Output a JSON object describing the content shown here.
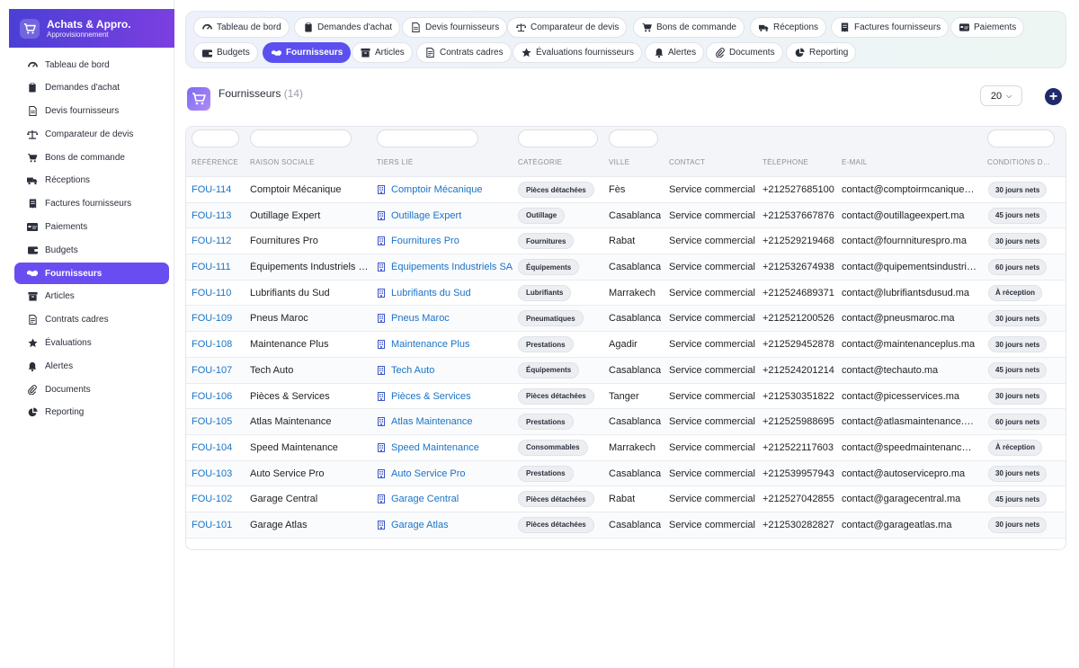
{
  "app": {
    "title": "Achats & Appro.",
    "subtitle": "Approvisionnement"
  },
  "colors": {
    "accent": "#6a4df0",
    "tab_active": "#5b50ef",
    "link": "#1a73c7",
    "add_button": "#1f2a6b"
  },
  "sidebar": {
    "items": [
      {
        "label": "Tableau de bord",
        "icon": "dashboard-icon"
      },
      {
        "label": "Demandes d'achat",
        "icon": "clipboard-icon"
      },
      {
        "label": "Devis fournisseurs",
        "icon": "document-icon"
      },
      {
        "label": "Comparateur de devis",
        "icon": "scale-icon"
      },
      {
        "label": "Bons de commande",
        "icon": "cart-icon"
      },
      {
        "label": "Réceptions",
        "icon": "truck-icon"
      },
      {
        "label": "Factures fournisseurs",
        "icon": "invoice-icon"
      },
      {
        "label": "Paiements",
        "icon": "card-icon"
      },
      {
        "label": "Budgets",
        "icon": "wallet-icon"
      },
      {
        "label": "Fournisseurs",
        "icon": "handshake-icon",
        "active": true
      },
      {
        "label": "Articles",
        "icon": "box-icon"
      },
      {
        "label": "Contrats cadres",
        "icon": "contract-icon"
      },
      {
        "label": "Évaluations",
        "icon": "star-icon"
      },
      {
        "label": "Alertes",
        "icon": "bell-icon"
      },
      {
        "label": "Documents",
        "icon": "paperclip-icon"
      },
      {
        "label": "Reporting",
        "icon": "pie-chart-icon"
      }
    ]
  },
  "tabs": {
    "items": [
      {
        "label": "Tableau de bord",
        "icon": "dashboard-icon"
      },
      {
        "label": "Demandes d'achat",
        "icon": "clipboard-icon"
      },
      {
        "label": "Devis fournisseurs",
        "icon": "document-icon"
      },
      {
        "label": "Comparateur de devis",
        "icon": "scale-icon"
      },
      {
        "label": "Bons de commande",
        "icon": "cart-icon"
      },
      {
        "label": "Réceptions",
        "icon": "truck-icon"
      },
      {
        "label": "Factures fournisseurs",
        "icon": "invoice-icon"
      },
      {
        "label": "Paiements",
        "icon": "card-icon"
      },
      {
        "label": "Budgets",
        "icon": "wallet-icon"
      },
      {
        "label": "Fournisseurs",
        "icon": "handshake-icon",
        "active": true
      },
      {
        "label": "Articles",
        "icon": "box-icon"
      },
      {
        "label": "Contrats cadres",
        "icon": "contract-icon"
      },
      {
        "label": "Évaluations fournisseurs",
        "icon": "star-icon"
      },
      {
        "label": "Alertes",
        "icon": "bell-icon"
      },
      {
        "label": "Documents",
        "icon": "paperclip-icon"
      },
      {
        "label": "Reporting",
        "icon": "pie-chart-icon"
      }
    ]
  },
  "page": {
    "title": "Fournisseurs",
    "count": "(14)",
    "page_size": "20"
  },
  "table": {
    "columns": [
      "RÉFÉRENCE",
      "RAISON SOCIALE",
      "TIERS LIÉ",
      "CATÉGORIE",
      "VILLE",
      "CONTACT",
      "TÉLÉPHONE",
      "E-MAIL",
      "CONDITIONS D…"
    ],
    "rows": [
      {
        "ref": "FOU-114",
        "raison": "Comptoir Mécanique",
        "tiers": "Comptoir Mécanique",
        "categorie": "Pièces détachées",
        "ville": "Fès",
        "contact": "Service commercial",
        "tel": "+212527685100",
        "email": "contact@comptoirmcanique.ma",
        "conditions": "30 jours nets"
      },
      {
        "ref": "FOU-113",
        "raison": "Outillage Expert",
        "tiers": "Outillage Expert",
        "categorie": "Outillage",
        "ville": "Casablanca",
        "contact": "Service commercial",
        "tel": "+212537667876",
        "email": "contact@outillageexpert.ma",
        "conditions": "45 jours nets"
      },
      {
        "ref": "FOU-112",
        "raison": "Fournitures Pro",
        "tiers": "Fournitures Pro",
        "categorie": "Fournitures",
        "ville": "Rabat",
        "contact": "Service commercial",
        "tel": "+212529219468",
        "email": "contact@fournniturespro.ma",
        "conditions": "30 jours nets"
      },
      {
        "ref": "FOU-111",
        "raison": "Équipements Industriels SA",
        "tiers": "Équipements Industriels SA",
        "categorie": "Équipements",
        "ville": "Casablanca",
        "contact": "Service commercial",
        "tel": "+212532674938",
        "email": "contact@quipementsindustrie…",
        "conditions": "60 jours nets"
      },
      {
        "ref": "FOU-110",
        "raison": "Lubrifiants du Sud",
        "tiers": "Lubrifiants du Sud",
        "categorie": "Lubrifiants",
        "ville": "Marrakech",
        "contact": "Service commercial",
        "tel": "+212524689371",
        "email": "contact@lubrifiantsdusud.ma",
        "conditions": "À réception"
      },
      {
        "ref": "FOU-109",
        "raison": "Pneus Maroc",
        "tiers": "Pneus Maroc",
        "categorie": "Pneumatiques",
        "ville": "Casablanca",
        "contact": "Service commercial",
        "tel": "+212521200526",
        "email": "contact@pneusmaroc.ma",
        "conditions": "30 jours nets"
      },
      {
        "ref": "FOU-108",
        "raison": "Maintenance Plus",
        "tiers": "Maintenance Plus",
        "categorie": "Prestations",
        "ville": "Agadir",
        "contact": "Service commercial",
        "tel": "+212529452878",
        "email": "contact@maintenanceplus.ma",
        "conditions": "30 jours nets"
      },
      {
        "ref": "FOU-107",
        "raison": "Tech Auto",
        "tiers": "Tech Auto",
        "categorie": "Équipements",
        "ville": "Casablanca",
        "contact": "Service commercial",
        "tel": "+212524201214",
        "email": "contact@techauto.ma",
        "conditions": "45 jours nets"
      },
      {
        "ref": "FOU-106",
        "raison": "Pièces & Services",
        "tiers": "Pièces & Services",
        "categorie": "Pièces détachées",
        "ville": "Tanger",
        "contact": "Service commercial",
        "tel": "+212530351822",
        "email": "contact@picesservices.ma",
        "conditions": "30 jours nets"
      },
      {
        "ref": "FOU-105",
        "raison": "Atlas Maintenance",
        "tiers": "Atlas Maintenance",
        "categorie": "Prestations",
        "ville": "Casablanca",
        "contact": "Service commercial",
        "tel": "+212525988695",
        "email": "contact@atlasmaintenance.ma",
        "conditions": "60 jours nets"
      },
      {
        "ref": "FOU-104",
        "raison": "Speed Maintenance",
        "tiers": "Speed Maintenance",
        "categorie": "Consommables",
        "ville": "Marrakech",
        "contact": "Service commercial",
        "tel": "+212522117603",
        "email": "contact@speedmaintenance.…",
        "conditions": "À réception"
      },
      {
        "ref": "FOU-103",
        "raison": "Auto Service Pro",
        "tiers": "Auto Service Pro",
        "categorie": "Prestations",
        "ville": "Casablanca",
        "contact": "Service commercial",
        "tel": "+212539957943",
        "email": "contact@autoservicepro.ma",
        "conditions": "30 jours nets"
      },
      {
        "ref": "FOU-102",
        "raison": "Garage Central",
        "tiers": "Garage Central",
        "categorie": "Pièces détachées",
        "ville": "Rabat",
        "contact": "Service commercial",
        "tel": "+212527042855",
        "email": "contact@garagecentral.ma",
        "conditions": "45 jours nets"
      },
      {
        "ref": "FOU-101",
        "raison": "Garage Atlas",
        "tiers": "Garage Atlas",
        "categorie": "Pièces détachées",
        "ville": "Casablanca",
        "contact": "Service commercial",
        "tel": "+212530282827",
        "email": "contact@garageatlas.ma",
        "conditions": "30 jours nets"
      }
    ]
  }
}
